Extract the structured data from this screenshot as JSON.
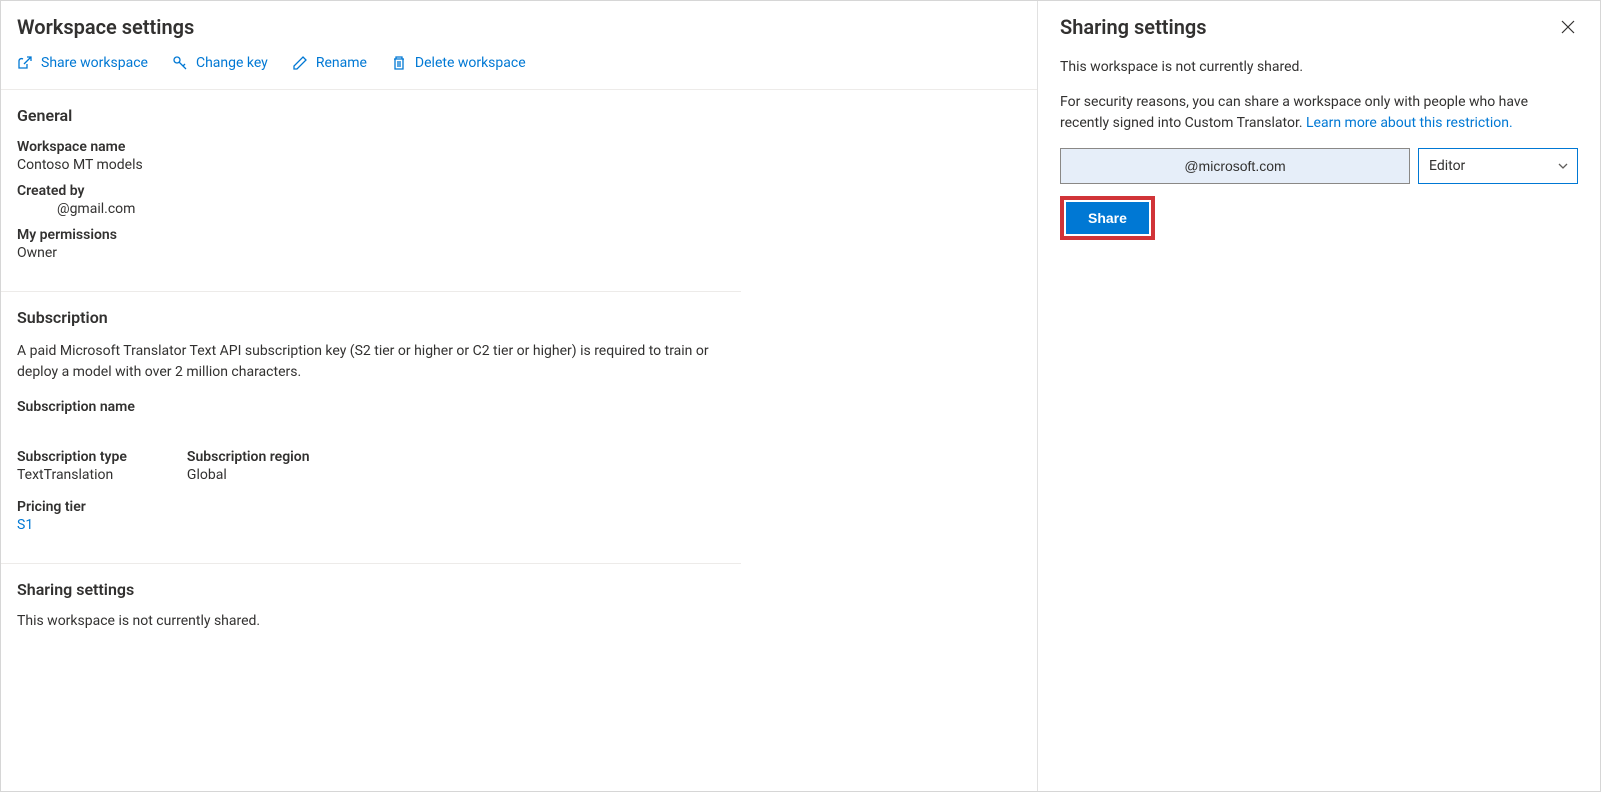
{
  "main": {
    "title": "Workspace settings",
    "toolbar": {
      "share": "Share workspace",
      "changeKey": "Change key",
      "rename": "Rename",
      "delete": "Delete workspace"
    },
    "general": {
      "heading": "General",
      "workspaceNameLabel": "Workspace name",
      "workspaceNameValue": "Contoso MT models",
      "createdByLabel": "Created by",
      "createdByValue": "@gmail.com",
      "permissionsLabel": "My permissions",
      "permissionsValue": "Owner"
    },
    "subscription": {
      "heading": "Subscription",
      "desc": "A paid Microsoft Translator Text API subscription key (S2 tier or higher or C2 tier or higher) is required to train or deploy a model with over 2 million characters.",
      "nameLabel": "Subscription name",
      "typeLabel": "Subscription type",
      "typeValue": "TextTranslation",
      "regionLabel": "Subscription region",
      "regionValue": "Global",
      "tierLabel": "Pricing tier",
      "tierValue": "S1"
    },
    "sharing": {
      "heading": "Sharing settings",
      "status": "This workspace is not currently shared."
    }
  },
  "panel": {
    "title": "Sharing settings",
    "status": "This workspace is not currently shared.",
    "infoPrefix": "For security reasons, you can share a workspace only with people who have recently signed into Custom Translator. ",
    "infoLink": "Learn more about this restriction.",
    "emailValue": "@microsoft.com",
    "roleValue": "Editor",
    "shareButton": "Share"
  }
}
